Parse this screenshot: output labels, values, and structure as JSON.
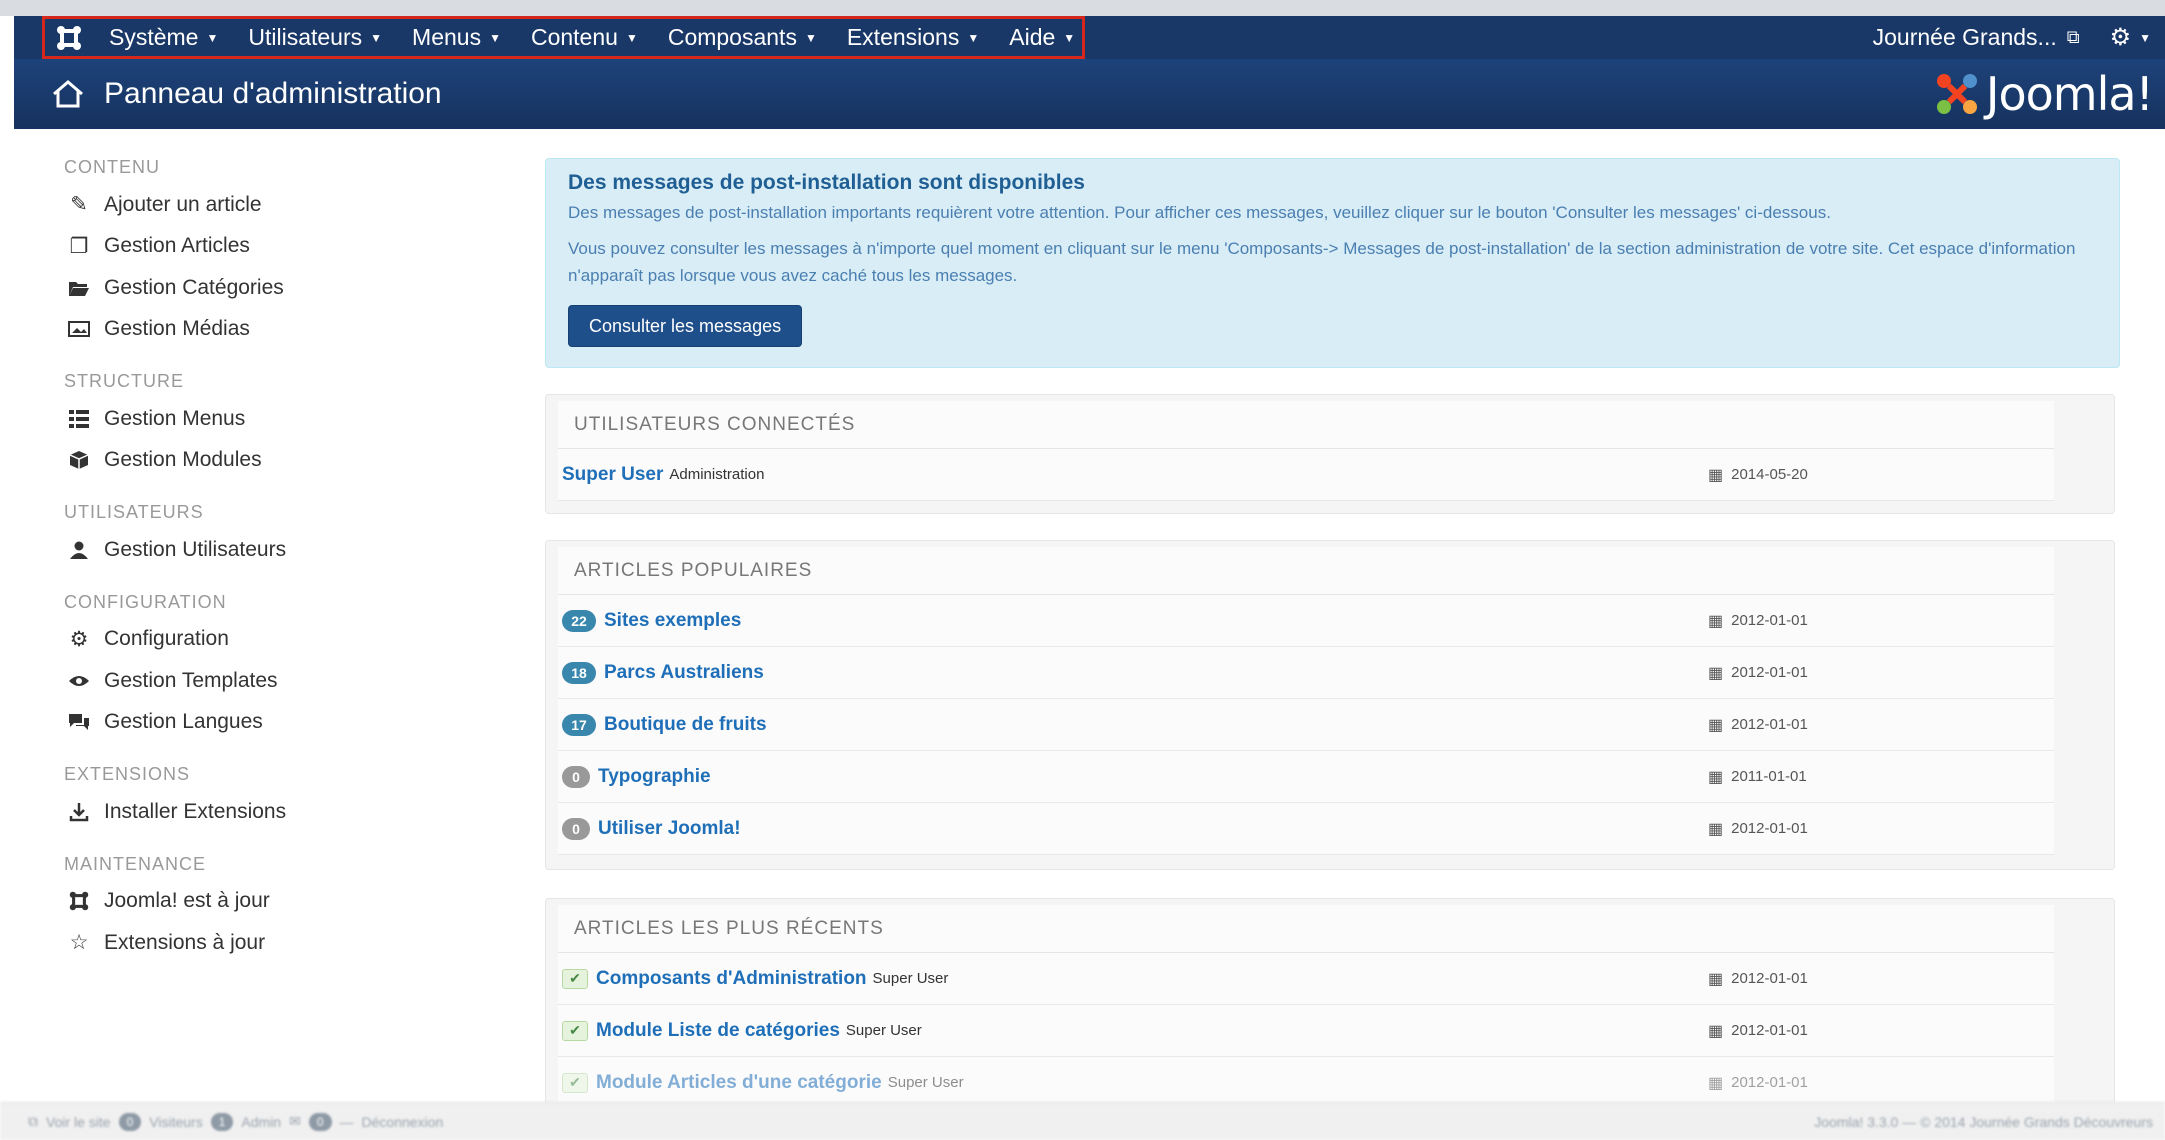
{
  "topnav": {
    "items": [
      {
        "label": "Système"
      },
      {
        "label": "Utilisateurs"
      },
      {
        "label": "Menus"
      },
      {
        "label": "Contenu"
      },
      {
        "label": "Composants"
      },
      {
        "label": "Extensions"
      },
      {
        "label": "Aide"
      }
    ],
    "site_link": "Journée Grands...",
    "highlight_color": "#d6271c"
  },
  "header": {
    "title": "Panneau d'administration",
    "brand": "Joomla!",
    "bar_color": "#1a3867"
  },
  "sidebar": {
    "sections": [
      {
        "heading": "CONTENU",
        "items": [
          {
            "label": "Ajouter un article",
            "icon": "pencil-icon"
          },
          {
            "label": "Gestion Articles",
            "icon": "copy-icon"
          },
          {
            "label": "Gestion Catégories",
            "icon": "folder-open-icon"
          },
          {
            "label": "Gestion Médias",
            "icon": "image-icon"
          }
        ]
      },
      {
        "heading": "STRUCTURE",
        "items": [
          {
            "label": "Gestion Menus",
            "icon": "list-icon"
          },
          {
            "label": "Gestion Modules",
            "icon": "cube-icon"
          }
        ]
      },
      {
        "heading": "UTILISATEURS",
        "items": [
          {
            "label": "Gestion Utilisateurs",
            "icon": "users-icon"
          }
        ]
      },
      {
        "heading": "CONFIGURATION",
        "items": [
          {
            "label": "Configuration",
            "icon": "gear-icon"
          },
          {
            "label": "Gestion Templates",
            "icon": "eye-icon"
          },
          {
            "label": "Gestion Langues",
            "icon": "comments-icon"
          }
        ]
      },
      {
        "heading": "EXTENSIONS",
        "items": [
          {
            "label": "Installer Extensions",
            "icon": "download-icon"
          }
        ]
      },
      {
        "heading": "MAINTENANCE",
        "items": [
          {
            "label": "Joomla! est à jour",
            "icon": "joomla-icon"
          },
          {
            "label": "Extensions à jour",
            "icon": "star-icon"
          }
        ]
      }
    ]
  },
  "alert": {
    "title": "Des messages de post-installation sont disponibles",
    "text1": "Des messages de post-installation importants requièrent votre attention. Pour afficher ces messages, veuillez cliquer sur le bouton 'Consulter les messages' ci-dessous.",
    "text2": "Vous pouvez consulter les messages à n'importe quel moment en cliquant sur le menu 'Composants-> Messages de post-installation' de la section administration de votre site. Cet espace d'information n'apparaît pas lorsque vous avez caché tous les messages.",
    "button": "Consulter les messages"
  },
  "logged_users": {
    "heading": "UTILISATEURS CONNECTÉS",
    "rows": [
      {
        "name": "Super User",
        "sub": "Administration",
        "date": "2014-05-20"
      }
    ]
  },
  "popular": {
    "heading": "ARTICLES POPULAIRES",
    "rows": [
      {
        "hits": "22",
        "title": "Sites exemples",
        "date": "2012-01-01",
        "badge_color": "#3a87ad"
      },
      {
        "hits": "18",
        "title": "Parcs Australiens",
        "date": "2012-01-01",
        "badge_color": "#3a87ad"
      },
      {
        "hits": "17",
        "title": "Boutique de fruits",
        "date": "2012-01-01",
        "badge_color": "#3a87ad"
      },
      {
        "hits": "0",
        "title": "Typographie",
        "date": "2011-01-01",
        "badge_color": "#999999"
      },
      {
        "hits": "0",
        "title": "Utiliser Joomla!",
        "date": "2012-01-01",
        "badge_color": "#999999"
      }
    ]
  },
  "recent": {
    "heading": "ARTICLES LES PLUS RÉCENTS",
    "rows": [
      {
        "title": "Composants d'Administration",
        "author": "Super User",
        "date": "2012-01-01"
      },
      {
        "title": "Module Liste de catégories",
        "author": "Super User",
        "date": "2012-01-01"
      },
      {
        "title": "Module Articles d'une catégorie",
        "author": "Super User",
        "date": "2012-01-01"
      }
    ]
  },
  "footer": {
    "view_site": "Voir le site",
    "visitors_count": "0",
    "visitors_label": "Visiteurs",
    "admins_count": "1",
    "admins_label": "Admin",
    "messages_count": "0",
    "logout": "Déconnexion",
    "copyright": "Joomla! 3.3.0 — © 2014 Journée Grands Découvreurs"
  }
}
